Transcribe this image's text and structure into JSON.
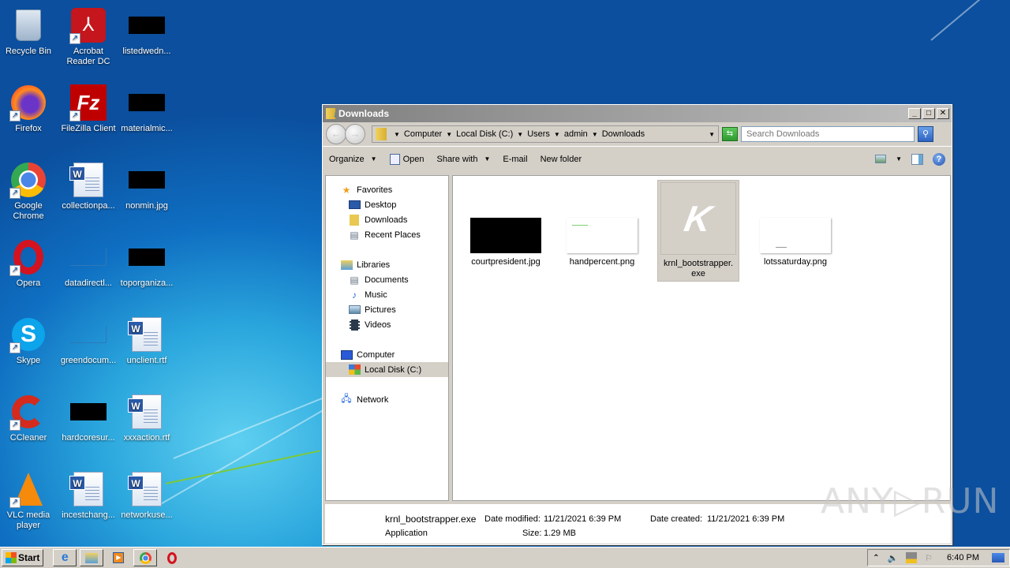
{
  "desktop": {
    "icons": [
      {
        "label": "Recycle Bin",
        "icon": "recycle-bin-icon"
      },
      {
        "label": "Acrobat Reader DC",
        "icon": "acrobat-icon"
      },
      {
        "label": "listedwedn...",
        "icon": "image-thumbnail-icon"
      },
      {
        "label": "Firefox",
        "icon": "firefox-icon"
      },
      {
        "label": "FileZilla Client",
        "icon": "filezilla-icon"
      },
      {
        "label": "materialmic...",
        "icon": "image-thumbnail-icon"
      },
      {
        "label": "Google Chrome",
        "icon": "chrome-icon"
      },
      {
        "label": "collectionpa...",
        "icon": "word-doc-icon"
      },
      {
        "label": "nonmin.jpg",
        "icon": "image-thumbnail-icon"
      },
      {
        "label": "Opera",
        "icon": "opera-icon"
      },
      {
        "label": "datadirectl...",
        "icon": "blank-file-icon"
      },
      {
        "label": "toporganiza...",
        "icon": "image-thumbnail-icon"
      },
      {
        "label": "Skype",
        "icon": "skype-icon"
      },
      {
        "label": "greendocum...",
        "icon": "blank-file-icon"
      },
      {
        "label": "unclient.rtf",
        "icon": "word-doc-icon"
      },
      {
        "label": "CCleaner",
        "icon": "ccleaner-icon"
      },
      {
        "label": "hardcoresur...",
        "icon": "image-thumbnail-icon"
      },
      {
        "label": "xxxaction.rtf",
        "icon": "word-doc-icon"
      },
      {
        "label": "VLC media player",
        "icon": "vlc-icon"
      },
      {
        "label": "incestchang...",
        "icon": "word-doc-icon"
      },
      {
        "label": "networkuse...",
        "icon": "word-doc-icon"
      }
    ]
  },
  "window": {
    "title": "Downloads",
    "breadcrumbs": [
      "Computer",
      "Local Disk (C:)",
      "Users",
      "admin",
      "Downloads"
    ],
    "search_placeholder": "Search Downloads",
    "toolbar": {
      "organize": "Organize",
      "open": "Open",
      "share_with": "Share with",
      "email": "E-mail",
      "new_folder": "New folder"
    },
    "nav_pane": {
      "favorites": "Favorites",
      "desktop": "Desktop",
      "downloads": "Downloads",
      "recent_places": "Recent Places",
      "libraries": "Libraries",
      "documents": "Documents",
      "music": "Music",
      "pictures": "Pictures",
      "videos": "Videos",
      "computer": "Computer",
      "local_disk": "Local Disk (C:)",
      "network": "Network"
    },
    "files": [
      {
        "name": "courtpresident.jpg",
        "selected": false
      },
      {
        "name": "handpercent.png",
        "selected": false
      },
      {
        "name": "krnl_bootstrapper.exe",
        "selected": true
      },
      {
        "name": "lotssaturday.png",
        "selected": false
      }
    ],
    "details": {
      "name": "krnl_bootstrapper.exe",
      "type": "Application",
      "date_modified_label": "Date modified:",
      "date_modified": "11/21/2021 6:39 PM",
      "date_created_label": "Date created:",
      "date_created": "11/21/2021 6:39 PM",
      "size_label": "Size:",
      "size": "1.29 MB"
    }
  },
  "taskbar": {
    "start_label": "Start",
    "apps": [
      "internet-explorer-icon",
      "windows-explorer-icon",
      "media-player-icon",
      "chrome-icon",
      "opera-icon"
    ],
    "clock": "6:40 PM"
  },
  "watermark": "ANY▷RUN"
}
